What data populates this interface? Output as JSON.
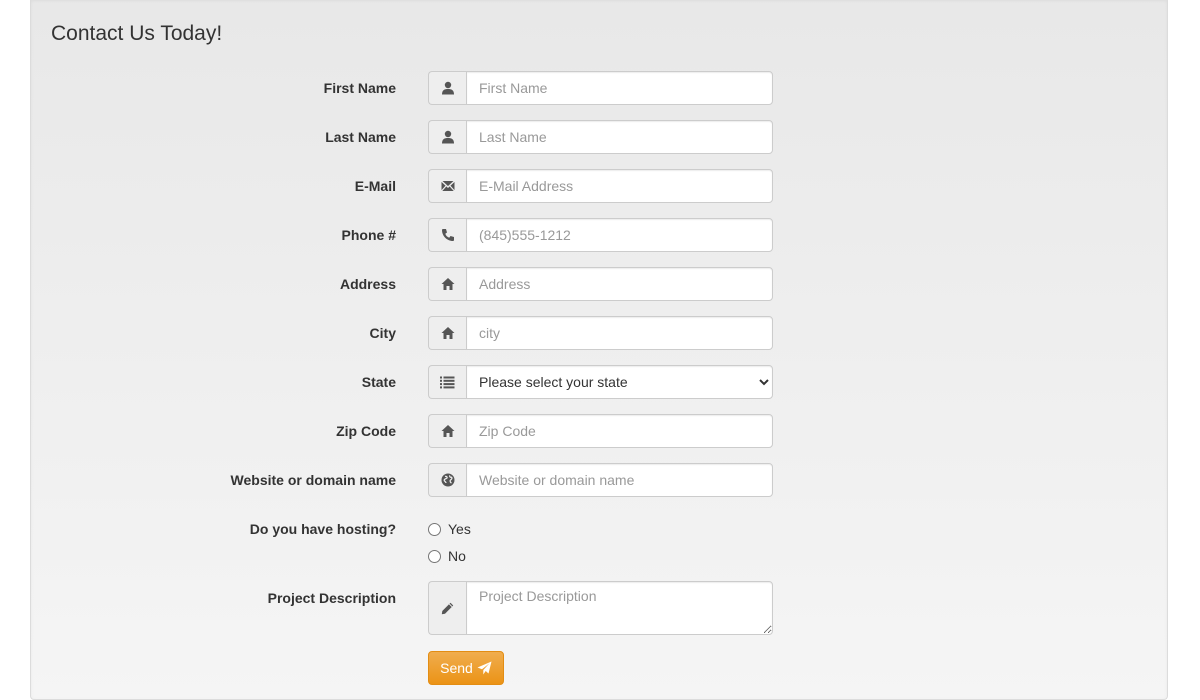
{
  "form": {
    "title": "Contact Us Today!",
    "fields": {
      "first_name": {
        "label": "First Name",
        "placeholder": "First Name",
        "icon": "user-icon"
      },
      "last_name": {
        "label": "Last Name",
        "placeholder": "Last Name",
        "icon": "user-icon"
      },
      "email": {
        "label": "E-Mail",
        "placeholder": "E-Mail Address",
        "icon": "envelope-icon"
      },
      "phone": {
        "label": "Phone #",
        "placeholder": "(845)555-1212",
        "icon": "phone-icon"
      },
      "address": {
        "label": "Address",
        "placeholder": "Address",
        "icon": "home-icon"
      },
      "city": {
        "label": "City",
        "placeholder": "city",
        "icon": "home-icon"
      },
      "state": {
        "label": "State",
        "selected": "Please select your state",
        "icon": "list-icon"
      },
      "zip": {
        "label": "Zip Code",
        "placeholder": "Zip Code",
        "icon": "home-icon"
      },
      "website": {
        "label": "Website or domain name",
        "placeholder": "Website or domain name",
        "icon": "globe-icon"
      },
      "hosting": {
        "label": "Do you have hosting?",
        "options": [
          "Yes",
          "No"
        ]
      },
      "description": {
        "label": "Project Description",
        "placeholder": "Project Description",
        "icon": "pencil-icon"
      }
    },
    "submit": {
      "label": "Send",
      "icon": "send-icon"
    },
    "colors": {
      "button": "#f0ad4e",
      "addon_bg": "#eeeeee",
      "border": "#cccccc",
      "placeholder": "#999999"
    }
  }
}
